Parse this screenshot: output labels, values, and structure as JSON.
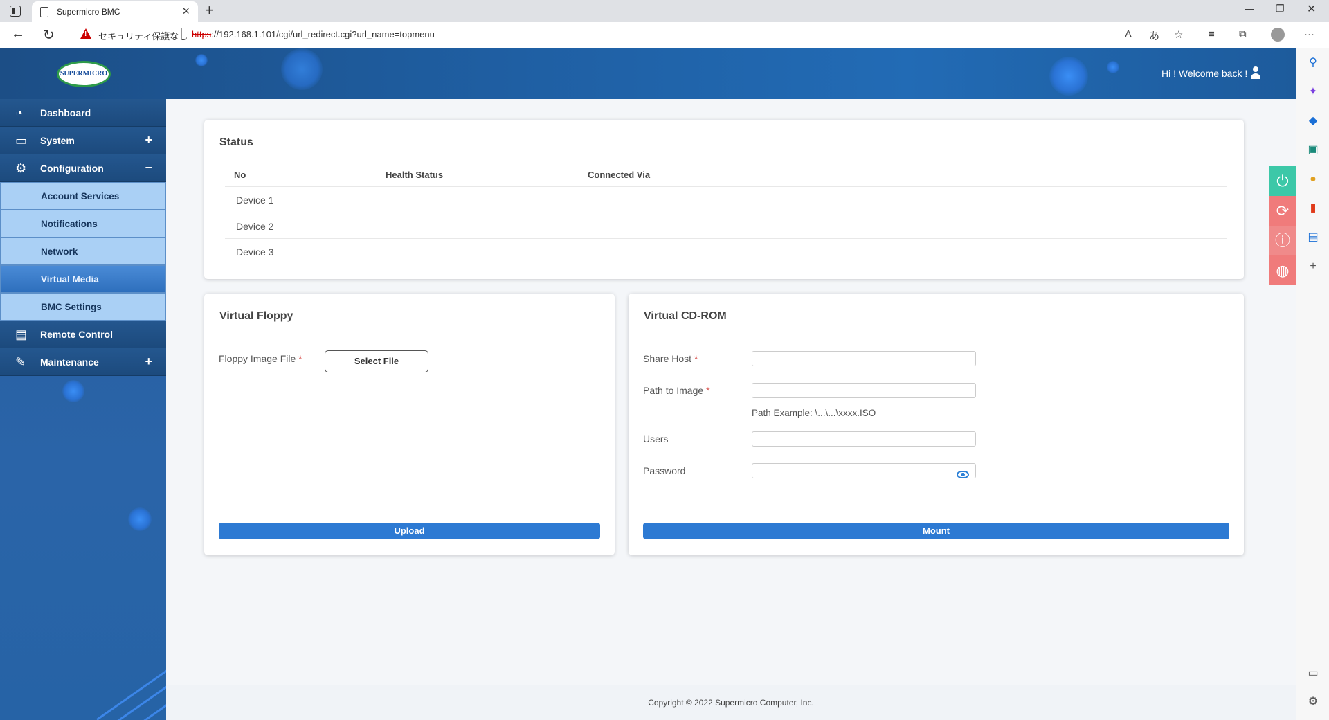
{
  "browser": {
    "tab_title": "Supermicro BMC",
    "insecure_label": "セキュリティ保護なし",
    "url_scheme": "https",
    "url_rest": "://192.168.1.101/cgi/url_redirect.cgi?url_name=topmenu"
  },
  "header": {
    "logo_text": "SUPERMICRO",
    "welcome": "Hi ! Welcome back !"
  },
  "sidebar": {
    "items": [
      {
        "label": "Dashboard"
      },
      {
        "label": "System",
        "toggle": "+"
      },
      {
        "label": "Configuration",
        "toggle": "−"
      },
      {
        "label": "Remote Control"
      },
      {
        "label": "Maintenance",
        "toggle": "+"
      }
    ],
    "sub_items": [
      {
        "label": "Account Services"
      },
      {
        "label": "Notifications"
      },
      {
        "label": "Network"
      },
      {
        "label": "Virtual Media",
        "active": true
      },
      {
        "label": "BMC Settings"
      }
    ]
  },
  "status": {
    "title": "Status",
    "columns": [
      "No",
      "Health Status",
      "Connected Via"
    ],
    "rows": [
      "Device 1",
      "Device 2",
      "Device 3"
    ]
  },
  "floppy": {
    "title": "Virtual Floppy",
    "file_label": "Floppy Image File",
    "required_mark": "*",
    "select_button": "Select File",
    "upload_button": "Upload"
  },
  "cdrom": {
    "title": "Virtual CD-ROM",
    "share_host_label": "Share Host",
    "path_label": "Path to Image",
    "path_hint": "Path Example: \\...\\...\\xxxx.ISO",
    "users_label": "Users",
    "password_label": "Password",
    "required_mark": "*",
    "share_host_value": "",
    "path_value": "",
    "users_value": "",
    "password_value": "",
    "mount_button": "Mount"
  },
  "fab_colors": {
    "power": "#3cc8a8",
    "refresh": "#f07b7b",
    "info": "#f08a8a",
    "language": "#f07b7b"
  },
  "footer": {
    "copyright": "Copyright © 2022 Supermicro Computer, Inc."
  }
}
